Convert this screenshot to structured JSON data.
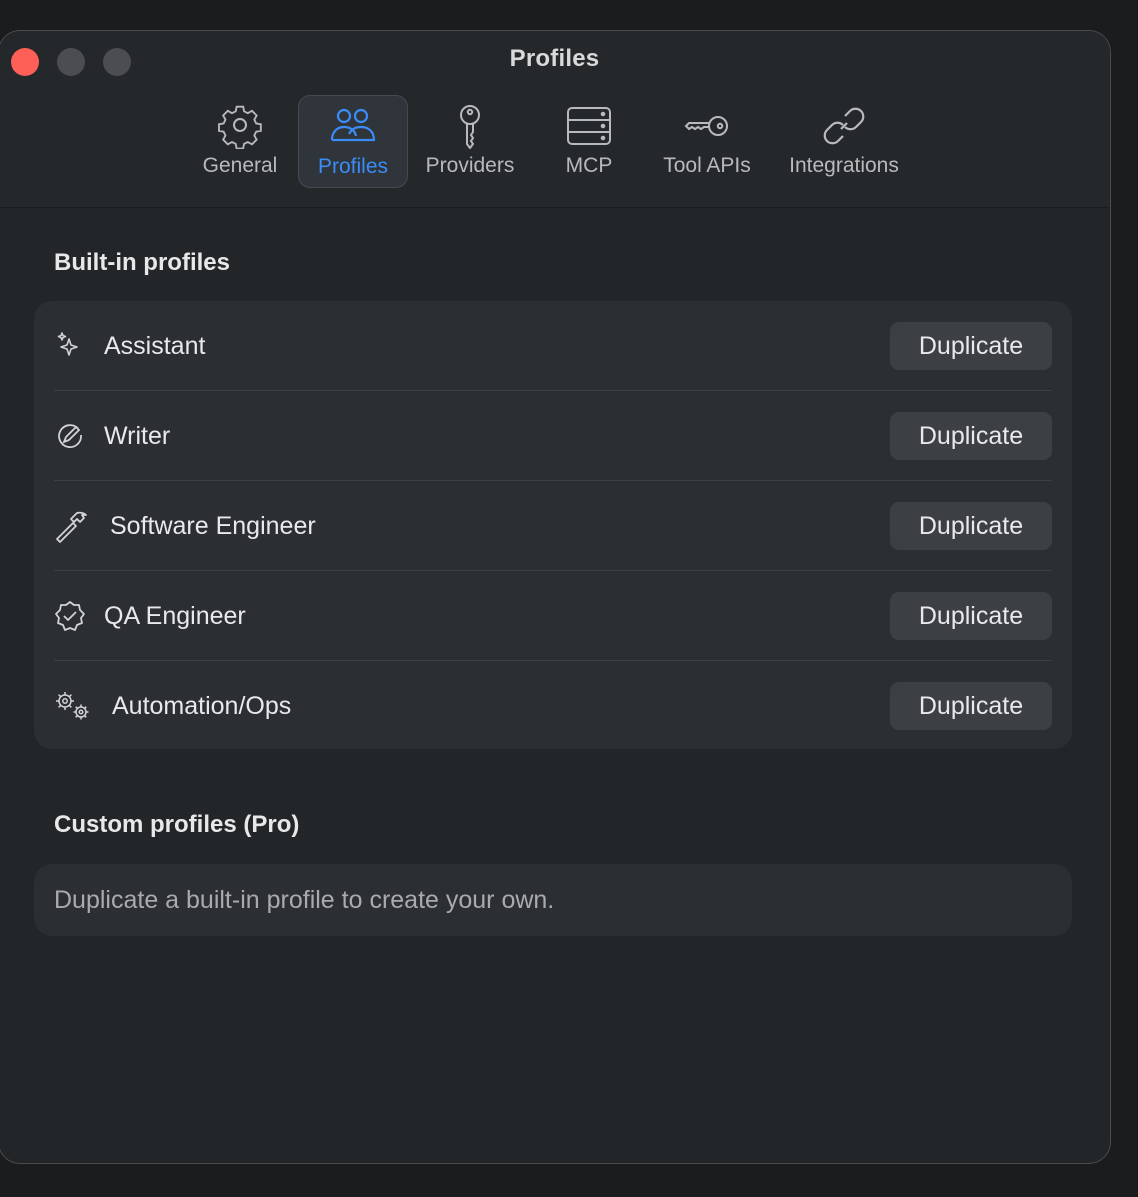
{
  "window": {
    "title": "Profiles"
  },
  "tabs": [
    {
      "label": "General",
      "icon": "gear-icon",
      "active": false
    },
    {
      "label": "Profiles",
      "icon": "people-icon",
      "active": true
    },
    {
      "label": "Providers",
      "icon": "key-icon",
      "active": false
    },
    {
      "label": "MCP",
      "icon": "server-icon",
      "active": false
    },
    {
      "label": "Tool APIs",
      "icon": "horizontal-key-icon",
      "active": false
    },
    {
      "label": "Integrations",
      "icon": "link-icon",
      "active": false
    }
  ],
  "builtin": {
    "title": "Built-in profiles",
    "profiles": [
      {
        "name": "Assistant",
        "icon": "sparkles-icon",
        "button": "Duplicate"
      },
      {
        "name": "Writer",
        "icon": "pen-circle-icon",
        "button": "Duplicate"
      },
      {
        "name": "Software Engineer",
        "icon": "hammer-icon",
        "button": "Duplicate"
      },
      {
        "name": "QA Engineer",
        "icon": "checkmark-seal-icon",
        "button": "Duplicate"
      },
      {
        "name": "Automation/Ops",
        "icon": "gears-icon",
        "button": "Duplicate"
      }
    ]
  },
  "custom": {
    "title": "Custom profiles (Pro)",
    "empty_message": "Duplicate a built-in profile to create your own."
  },
  "colors": {
    "accent": "#3b8cf6",
    "close": "#fe5f57",
    "background": "#232629"
  }
}
